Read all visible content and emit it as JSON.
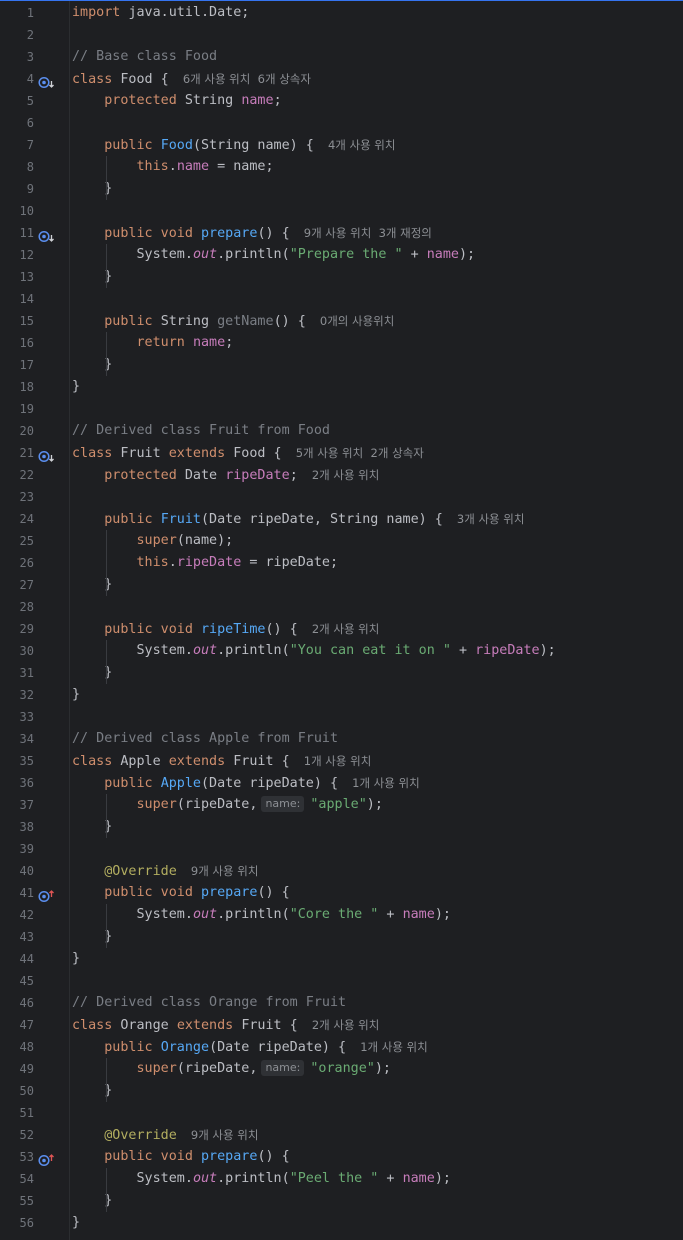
{
  "lines": [
    [
      {
        "t": "kw",
        "v": "import "
      },
      {
        "t": "txt",
        "v": "java.util.Date;"
      }
    ],
    [],
    [
      {
        "t": "cm",
        "v": "// Base class Food"
      }
    ],
    [
      {
        "t": "kw",
        "v": "class "
      },
      {
        "t": "txt",
        "v": "Food { "
      },
      {
        "t": "hint",
        "v": "6개 사용 위치  6개 상속자"
      }
    ],
    [
      {
        "t": "txt",
        "v": "    "
      },
      {
        "t": "kw",
        "v": "protected "
      },
      {
        "t": "txt",
        "v": "String "
      },
      {
        "t": "fd",
        "v": "name"
      },
      {
        "t": "txt",
        "v": ";"
      }
    ],
    [],
    [
      {
        "t": "txt",
        "v": "    "
      },
      {
        "t": "kw",
        "v": "public "
      },
      {
        "t": "mth",
        "v": "Food"
      },
      {
        "t": "txt",
        "v": "(String name) { "
      },
      {
        "t": "hint",
        "v": "4개 사용 위치"
      }
    ],
    [
      {
        "t": "txt",
        "v": "        "
      },
      {
        "t": "kw",
        "v": "this"
      },
      {
        "t": "txt",
        "v": "."
      },
      {
        "t": "fd",
        "v": "name"
      },
      {
        "t": "txt",
        "v": " = name;"
      }
    ],
    [
      {
        "t": "txt",
        "v": "    }"
      }
    ],
    [],
    [
      {
        "t": "txt",
        "v": "    "
      },
      {
        "t": "kw",
        "v": "public void "
      },
      {
        "t": "mth",
        "v": "prepare"
      },
      {
        "t": "txt",
        "v": "() { "
      },
      {
        "t": "hint",
        "v": "9개 사용 위치  3개 재정의"
      }
    ],
    [
      {
        "t": "txt",
        "v": "        System."
      },
      {
        "t": "st",
        "v": "out"
      },
      {
        "t": "txt",
        "v": ".println("
      },
      {
        "t": "str",
        "v": "\"Prepare the \""
      },
      {
        "t": "txt",
        "v": " + "
      },
      {
        "t": "fd",
        "v": "name"
      },
      {
        "t": "txt",
        "v": ");"
      }
    ],
    [
      {
        "t": "txt",
        "v": "    }"
      }
    ],
    [],
    [
      {
        "t": "txt",
        "v": "    "
      },
      {
        "t": "kw",
        "v": "public "
      },
      {
        "t": "txt",
        "v": "String "
      },
      {
        "t": "cm",
        "v": "getName"
      },
      {
        "t": "txt",
        "v": "() { "
      },
      {
        "t": "hint",
        "v": "0개의 사용위치"
      }
    ],
    [
      {
        "t": "txt",
        "v": "        "
      },
      {
        "t": "kw",
        "v": "return "
      },
      {
        "t": "fd",
        "v": "name"
      },
      {
        "t": "txt",
        "v": ";"
      }
    ],
    [
      {
        "t": "txt",
        "v": "    }"
      }
    ],
    [
      {
        "t": "txt",
        "v": "}"
      }
    ],
    [],
    [
      {
        "t": "cm",
        "v": "// Derived class Fruit from Food"
      }
    ],
    [
      {
        "t": "kw",
        "v": "class "
      },
      {
        "t": "txt",
        "v": "Fruit "
      },
      {
        "t": "kw",
        "v": "extends "
      },
      {
        "t": "txt",
        "v": "Food { "
      },
      {
        "t": "hint",
        "v": "5개 사용 위치  2개 상속자"
      }
    ],
    [
      {
        "t": "txt",
        "v": "    "
      },
      {
        "t": "kw",
        "v": "protected "
      },
      {
        "t": "txt",
        "v": "Date "
      },
      {
        "t": "fd",
        "v": "ripeDate"
      },
      {
        "t": "txt",
        "v": "; "
      },
      {
        "t": "hint",
        "v": "2개 사용 위치"
      }
    ],
    [],
    [
      {
        "t": "txt",
        "v": "    "
      },
      {
        "t": "kw",
        "v": "public "
      },
      {
        "t": "mth",
        "v": "Fruit"
      },
      {
        "t": "txt",
        "v": "(Date ripeDate, String name) { "
      },
      {
        "t": "hint",
        "v": "3개 사용 위치"
      }
    ],
    [
      {
        "t": "txt",
        "v": "        "
      },
      {
        "t": "kw",
        "v": "super"
      },
      {
        "t": "txt",
        "v": "(name);"
      }
    ],
    [
      {
        "t": "txt",
        "v": "        "
      },
      {
        "t": "kw",
        "v": "this"
      },
      {
        "t": "txt",
        "v": "."
      },
      {
        "t": "fd",
        "v": "ripeDate"
      },
      {
        "t": "txt",
        "v": " = ripeDate;"
      }
    ],
    [
      {
        "t": "txt",
        "v": "    }"
      }
    ],
    [],
    [
      {
        "t": "txt",
        "v": "    "
      },
      {
        "t": "kw",
        "v": "public void "
      },
      {
        "t": "mth",
        "v": "ripeTime"
      },
      {
        "t": "txt",
        "v": "() { "
      },
      {
        "t": "hint",
        "v": "2개 사용 위치"
      }
    ],
    [
      {
        "t": "txt",
        "v": "        System."
      },
      {
        "t": "st",
        "v": "out"
      },
      {
        "t": "txt",
        "v": ".println("
      },
      {
        "t": "str",
        "v": "\"You can eat it on \""
      },
      {
        "t": "txt",
        "v": " + "
      },
      {
        "t": "fd",
        "v": "ripeDate"
      },
      {
        "t": "txt",
        "v": ");"
      }
    ],
    [
      {
        "t": "txt",
        "v": "    }"
      }
    ],
    [
      {
        "t": "txt",
        "v": "}"
      }
    ],
    [],
    [
      {
        "t": "cm",
        "v": "// Derived class Apple from Fruit"
      }
    ],
    [
      {
        "t": "kw",
        "v": "class "
      },
      {
        "t": "txt",
        "v": "Apple "
      },
      {
        "t": "kw",
        "v": "extends "
      },
      {
        "t": "txt",
        "v": "Fruit { "
      },
      {
        "t": "hint",
        "v": "1개 사용 위치"
      }
    ],
    [
      {
        "t": "txt",
        "v": "    "
      },
      {
        "t": "kw",
        "v": "public "
      },
      {
        "t": "mth",
        "v": "Apple"
      },
      {
        "t": "txt",
        "v": "(Date ripeDate) { "
      },
      {
        "t": "hint",
        "v": "1개 사용 위치"
      }
    ],
    [
      {
        "t": "txt",
        "v": "        "
      },
      {
        "t": "kw",
        "v": "super"
      },
      {
        "t": "txt",
        "v": "(ripeDate,"
      },
      {
        "t": "phint",
        "v": "name:"
      },
      {
        "t": "str",
        "v": "\"apple\""
      },
      {
        "t": "txt",
        "v": ");"
      }
    ],
    [
      {
        "t": "txt",
        "v": "    }"
      }
    ],
    [],
    [
      {
        "t": "txt",
        "v": "    "
      },
      {
        "t": "ann",
        "v": "@Override"
      },
      {
        "t": "txt",
        "v": " "
      },
      {
        "t": "hint",
        "v": "9개 사용 위치"
      }
    ],
    [
      {
        "t": "txt",
        "v": "    "
      },
      {
        "t": "kw",
        "v": "public void "
      },
      {
        "t": "mth",
        "v": "prepare"
      },
      {
        "t": "txt",
        "v": "() {"
      }
    ],
    [
      {
        "t": "txt",
        "v": "        System."
      },
      {
        "t": "st",
        "v": "out"
      },
      {
        "t": "txt",
        "v": ".println("
      },
      {
        "t": "str",
        "v": "\"Core the \""
      },
      {
        "t": "txt",
        "v": " + "
      },
      {
        "t": "fd",
        "v": "name"
      },
      {
        "t": "txt",
        "v": ");"
      }
    ],
    [
      {
        "t": "txt",
        "v": "    }"
      }
    ],
    [
      {
        "t": "txt",
        "v": "}"
      }
    ],
    [],
    [
      {
        "t": "cm",
        "v": "// Derived class Orange from Fruit"
      }
    ],
    [
      {
        "t": "kw",
        "v": "class "
      },
      {
        "t": "txt",
        "v": "Orange "
      },
      {
        "t": "kw",
        "v": "extends "
      },
      {
        "t": "txt",
        "v": "Fruit { "
      },
      {
        "t": "hint",
        "v": "2개 사용 위치"
      }
    ],
    [
      {
        "t": "txt",
        "v": "    "
      },
      {
        "t": "kw",
        "v": "public "
      },
      {
        "t": "mth",
        "v": "Orange"
      },
      {
        "t": "txt",
        "v": "(Date ripeDate) { "
      },
      {
        "t": "hint",
        "v": "1개 사용 위치"
      }
    ],
    [
      {
        "t": "txt",
        "v": "        "
      },
      {
        "t": "kw",
        "v": "super"
      },
      {
        "t": "txt",
        "v": "(ripeDate,"
      },
      {
        "t": "phint",
        "v": "name:"
      },
      {
        "t": "str",
        "v": "\"orange\""
      },
      {
        "t": "txt",
        "v": ");"
      }
    ],
    [
      {
        "t": "txt",
        "v": "    }"
      }
    ],
    [],
    [
      {
        "t": "txt",
        "v": "    "
      },
      {
        "t": "ann",
        "v": "@Override"
      },
      {
        "t": "txt",
        "v": " "
      },
      {
        "t": "hint",
        "v": "9개 사용 위치"
      }
    ],
    [
      {
        "t": "txt",
        "v": "    "
      },
      {
        "t": "kw",
        "v": "public void "
      },
      {
        "t": "mth",
        "v": "prepare"
      },
      {
        "t": "txt",
        "v": "() {"
      }
    ],
    [
      {
        "t": "txt",
        "v": "        System."
      },
      {
        "t": "st",
        "v": "out"
      },
      {
        "t": "txt",
        "v": ".println("
      },
      {
        "t": "str",
        "v": "\"Peel the \""
      },
      {
        "t": "txt",
        "v": " + "
      },
      {
        "t": "fd",
        "v": "name"
      },
      {
        "t": "txt",
        "v": ");"
      }
    ],
    [
      {
        "t": "txt",
        "v": "    }"
      }
    ],
    [
      {
        "t": "txt",
        "v": "}"
      }
    ]
  ],
  "gutter_icons": [
    {
      "line": 4,
      "icon": "implemented-down-icon"
    },
    {
      "line": 11,
      "icon": "implemented-down-icon"
    },
    {
      "line": 21,
      "icon": "implemented-down-icon"
    },
    {
      "line": 41,
      "icon": "overrides-up-icon"
    },
    {
      "line": 53,
      "icon": "overrides-up-icon"
    }
  ],
  "colors": {
    "background": "#1e1f22",
    "keyword": "#cf8e6d",
    "comment": "#7a7e85",
    "field": "#c77dbb",
    "method": "#56a8f5",
    "string": "#6aab73",
    "annotation": "#b3ae60",
    "text": "#bcbec4",
    "line_number": "#6f737a",
    "hint": "#8c8f94"
  }
}
